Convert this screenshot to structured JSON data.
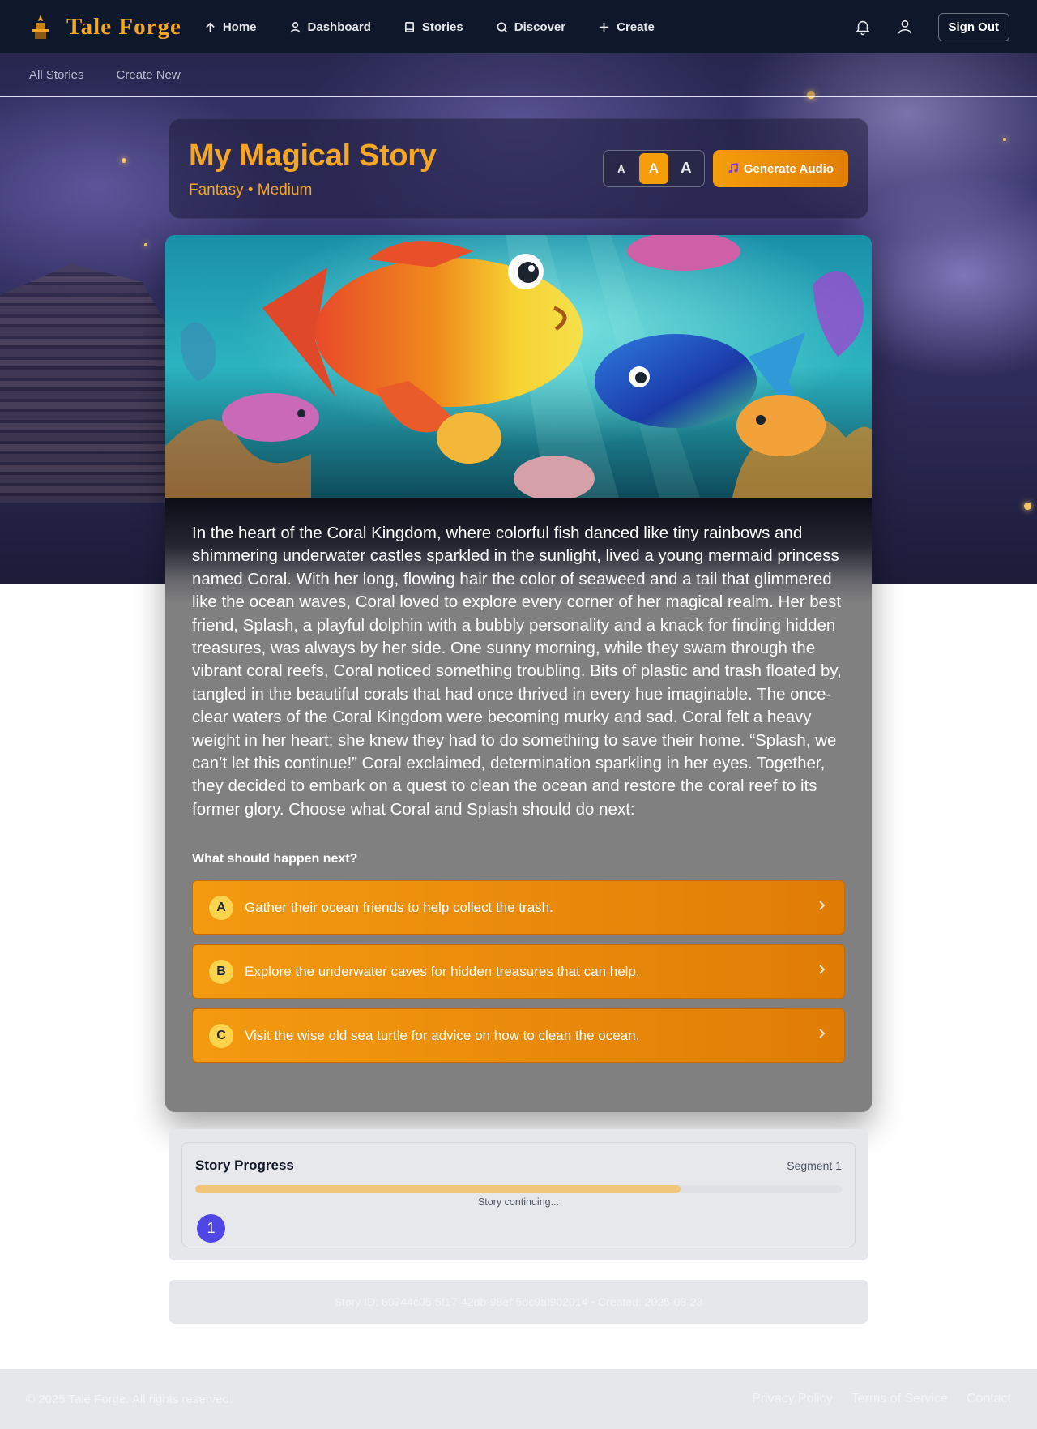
{
  "header": {
    "brand": "Tale Forge",
    "nav": [
      {
        "label": "Home",
        "icon": "home-icon"
      },
      {
        "label": "Dashboard",
        "icon": "user-icon"
      },
      {
        "label": "Stories",
        "icon": "book-icon"
      },
      {
        "label": "Discover",
        "icon": "search-icon"
      },
      {
        "label": "Create",
        "icon": "plus-icon"
      }
    ],
    "icons": [
      "bell-icon",
      "profile-icon"
    ],
    "sign_out": "Sign Out"
  },
  "subnav": {
    "items": [
      "All Stories",
      "Create New"
    ]
  },
  "story": {
    "title": "My Magical Story",
    "meta": "Fantasy • Medium",
    "font_sizes": [
      "A",
      "A",
      "A"
    ],
    "font_size_selected": "medium",
    "audio_button": "Generate Audio",
    "text": "In the heart of the Coral Kingdom, where colorful fish danced like tiny rainbows and shimmering underwater castles sparkled in the sunlight, lived a young mermaid princess named Coral. With her long, flowing hair the color of seaweed and a tail that glimmered like the ocean waves, Coral loved to explore every corner of her magical realm. Her best friend, Splash, a playful dolphin with a bubbly personality and a knack for finding hidden treasures, was always by her side. One sunny morning, while they swam through the vibrant coral reefs, Coral noticed something troubling. Bits of plastic and trash floated by, tangled in the beautiful corals that had once thrived in every hue imaginable. The once-clear waters of the Coral Kingdom were becoming murky and sad. Coral felt a heavy weight in her heart; she knew they had to do something to save their home. “Splash, we can’t let this continue!” Coral exclaimed, determination sparkling in her eyes. Together, they decided to embark on a quest to clean the ocean and restore the coral reef to its former glory. Choose what Coral and Splash should do next:",
    "question": "What should happen next?",
    "choices": [
      {
        "letter": "A",
        "text": "Gather their ocean friends to help collect the trash."
      },
      {
        "letter": "B",
        "text": "Explore the underwater caves for hidden treasures that can help."
      },
      {
        "letter": "C",
        "text": "Visit the wise old sea turtle for advice on how to clean the ocean."
      }
    ]
  },
  "progress": {
    "title": "Story Progress",
    "segment_label": "Segment 1",
    "fill_fraction": 0.75,
    "status": "Story continuing...",
    "current_segment": "1"
  },
  "meta": {
    "line": "Story ID: 60744c05-5f17-42db-98ef-5dc9af902014 • Created: 2025-08-23"
  },
  "footer": {
    "copyright": "© 2025 Tale Forge. All rights reserved.",
    "links": [
      "Privacy Policy",
      "Terms of Service",
      "Contact"
    ]
  },
  "colors": {
    "brand": "#f5a623",
    "nav_bg": "#0f172a",
    "choice_bg": "#f49a10",
    "segment_dot": "#4f46e5",
    "progress_fill": "#f0c77a"
  }
}
